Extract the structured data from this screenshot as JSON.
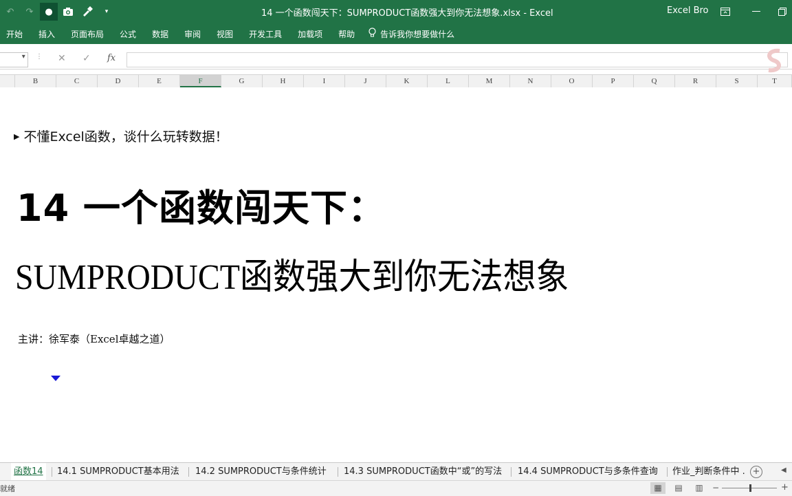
{
  "title_bar": {
    "title": "14 一个函数闯天下：SUMPRODUCT函数强大到你无法想象.xlsx  -  Excel",
    "user": "Excel Bro",
    "qat_icons": [
      "undo-icon",
      "redo-icon",
      "dot-icon",
      "camera-icon",
      "format-painter-icon",
      "customize-icon"
    ]
  },
  "ribbon": {
    "tabs": [
      "开始",
      "插入",
      "页面布局",
      "公式",
      "数据",
      "审阅",
      "视图",
      "开发工具",
      "加载项",
      "帮助"
    ],
    "tell_me": "告诉我你想要做什么"
  },
  "formula_bar": {
    "fx": "fx",
    "value": ""
  },
  "columns": [
    "B",
    "C",
    "D",
    "E",
    "F",
    "G",
    "H",
    "I",
    "J",
    "K",
    "L",
    "M",
    "N",
    "O",
    "P",
    "Q",
    "R",
    "S",
    "T"
  ],
  "selected_column": "F",
  "sheet": {
    "bullet": "不懂Excel函数，谈什么玩转数据！",
    "title_line1": "14 一个函数闯天下：",
    "title_line2": "SUMPRODUCT函数强大到你无法想象",
    "presenter": "主讲：徐军泰（Excel卓越之道）"
  },
  "sheet_tabs": [
    "函数14",
    "14.1 SUMPRODUCT基本用法",
    "14.2 SUMPRODUCT与条件统计",
    "14.3 SUMPRODUCT函数中“或”的写法",
    "14.4 SUMPRODUCT与多条件查询",
    "作业_判断条件中 ..."
  ],
  "active_sheet_index": 0,
  "status": {
    "left": "就绪"
  },
  "colors": {
    "accent": "#217346",
    "selected_tab_text": "#217346",
    "marker": "#1a1ad6"
  }
}
